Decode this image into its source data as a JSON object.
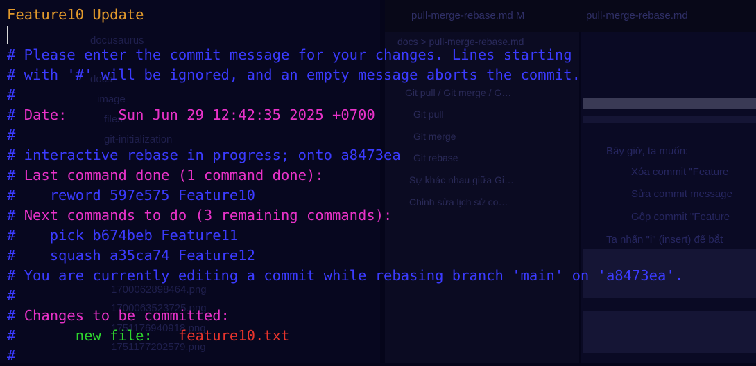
{
  "terminal": {
    "title_line": "Feature10 Update",
    "msg1": " Please enter the commit message for your changes. Lines starting",
    "msg2": " with '#' will be ignored, and an empty message aborts the commit.",
    "date_label": "Date:",
    "date_value": "Sun Jun 29 12:42:35 2025 +0700",
    "rebase_status": " interactive rebase in progress; onto a8473ea",
    "last_done_header": "Last command done (1 command done):",
    "last_done_cmd": "reword 597e575 Feature10",
    "next_header": "Next commands to do (3 remaining commands):",
    "next_cmd1": "pick b674beb Feature11",
    "next_cmd2": "squash a35ca74 Feature12",
    "editing_line": " You are currently editing a commit while rebasing branch 'main' on 'a8473ea'.",
    "changes_header": "Changes to be committed:",
    "new_file_label": "new file:",
    "new_file_name": "feature10.txt",
    "hash": "#"
  },
  "background": {
    "tab1": "pull-merge-rebase.md  M",
    "tab2": "pull-merge-rebase.md",
    "breadcrumb": "docs  >  pull-merge-rebase.md",
    "outline_items": [
      "Git pull / Git merge / G…",
      "Git pull",
      "Git merge",
      "Git rebase",
      "Sự khác nhau giữa Gi…",
      "Chỉnh sửa lịch sử co…"
    ],
    "preview_lines": [
      "Bây giờ, ta muốn:",
      "Xóa commit \"Feature",
      "Sửa commit message",
      "Gộp commit \"Feature",
      "Ta nhấn \"i\" (insert) để bắt"
    ],
    "files": [
      "docusaurus",
      "docs",
      "image",
      "files",
      "git-initialization",
      "1700062898464.png",
      "1700063523725.png",
      "1751176940918.png",
      "1751177202579.png"
    ]
  }
}
